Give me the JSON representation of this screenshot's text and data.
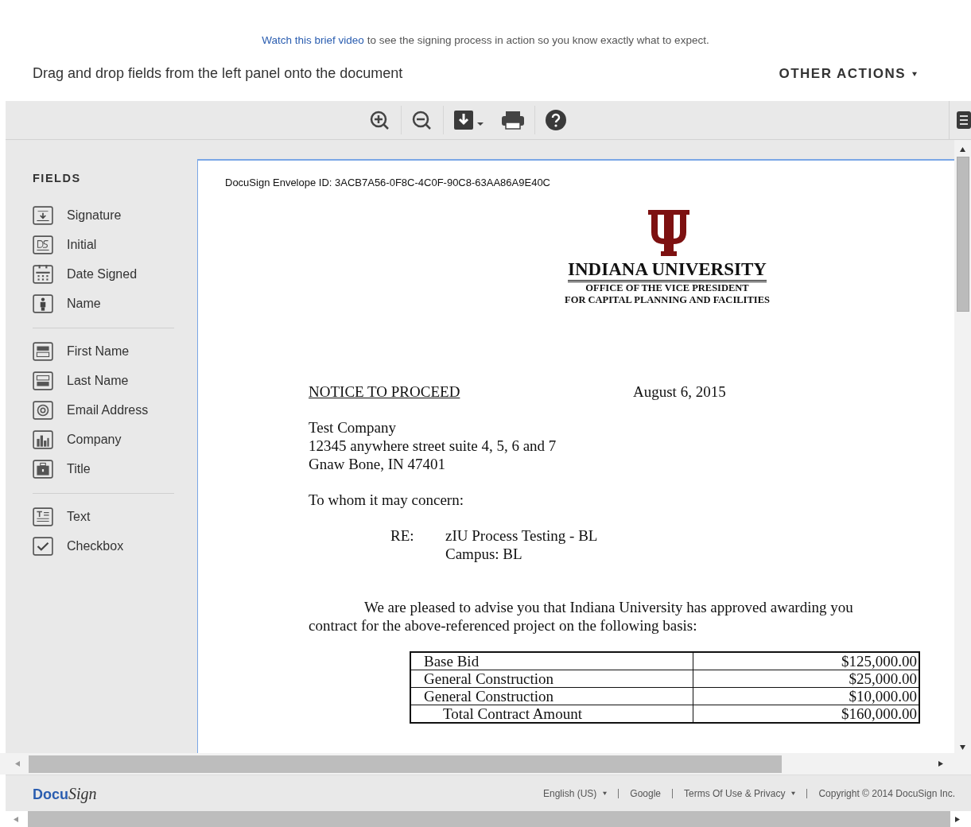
{
  "intro": {
    "link": "Watch this brief video",
    "text": "to see the signing process in action so you know exactly what to expect."
  },
  "instruction": "Drag and drop fields from the left panel onto the document",
  "other_actions": "OTHER ACTIONS",
  "sidebar": {
    "title": "FIELDS",
    "groups": [
      [
        {
          "label": "Signature",
          "kind": "signature"
        },
        {
          "label": "Initial",
          "kind": "initial"
        },
        {
          "label": "Date Signed",
          "kind": "date"
        },
        {
          "label": "Name",
          "kind": "person"
        }
      ],
      [
        {
          "label": "First Name",
          "kind": "first"
        },
        {
          "label": "Last Name",
          "kind": "last"
        },
        {
          "label": "Email Address",
          "kind": "email"
        },
        {
          "label": "Company",
          "kind": "company"
        },
        {
          "label": "Title",
          "kind": "title"
        }
      ],
      [
        {
          "label": "Text",
          "kind": "text"
        },
        {
          "label": "Checkbox",
          "kind": "checkbox"
        }
      ]
    ]
  },
  "document": {
    "envelope_id": "DocuSign Envelope ID: 3ACB7A56-0F8C-4C0F-90C8-63AA86A9E40C",
    "org": "INDIANA UNIVERSITY",
    "office": "OFFICE OF THE VICE PRESIDENT",
    "dept": "FOR CAPITAL PLANNING AND FACILITIES",
    "heading": "NOTICE TO PROCEED",
    "date": "August 6, 2015",
    "address": [
      "Test Company",
      "12345 anywhere street suite 4, 5, 6 and 7",
      "Gnaw Bone, IN 47401"
    ],
    "salutation": "To whom it may concern:",
    "re_label": "RE:",
    "re_lines": [
      "zIU Process Testing - BL",
      "Campus: BL"
    ],
    "body": [
      "We are pleased to advise you that Indiana University has approved awarding you",
      "contract for the above-referenced project on the following basis:"
    ],
    "table": [
      {
        "label": "Base Bid",
        "amount": "$125,000.00",
        "total": false
      },
      {
        "label": "General Construction",
        "amount": "$25,000.00",
        "total": false
      },
      {
        "label": "General Construction",
        "amount": "$10,000.00",
        "total": false
      },
      {
        "label": "Total Contract Amount",
        "amount": "$160,000.00",
        "total": true
      }
    ]
  },
  "footer": {
    "logo_left": "Docu",
    "logo_right": "Sign",
    "language": "English (US)",
    "links": [
      "Google"
    ],
    "terms": "Terms Of Use & Privacy",
    "copyright": "Copyright © 2014 DocuSign Inc."
  }
}
